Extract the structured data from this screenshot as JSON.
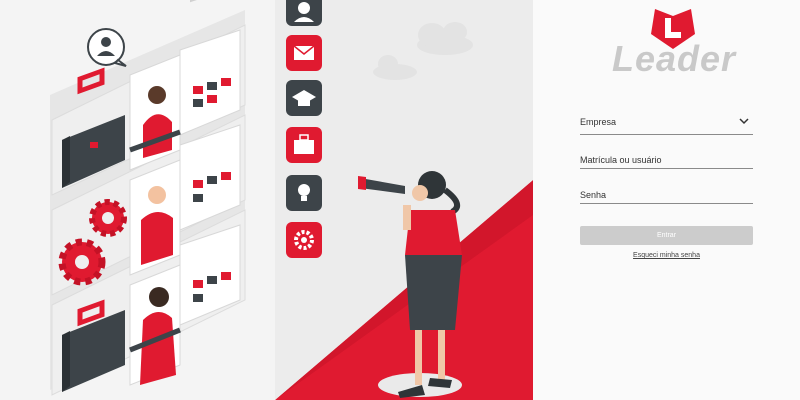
{
  "brand": {
    "name": "Leader",
    "accent_color": "#e0182d",
    "logo_icon": "leader-heart-logo"
  },
  "login": {
    "company_label": "Empresa",
    "user_placeholder": "Matrícula ou usuário",
    "password_placeholder": "Senha",
    "submit_label": "Entrar",
    "forgot_label": "Esqueci minha senha"
  },
  "illustration": {
    "icons": [
      "user-icon",
      "mail-icon",
      "graduation-cap-icon",
      "briefcase-icon",
      "lightbulb-icon",
      "gear-icon"
    ],
    "chat_icon": "user-chat-bubble-icon"
  }
}
